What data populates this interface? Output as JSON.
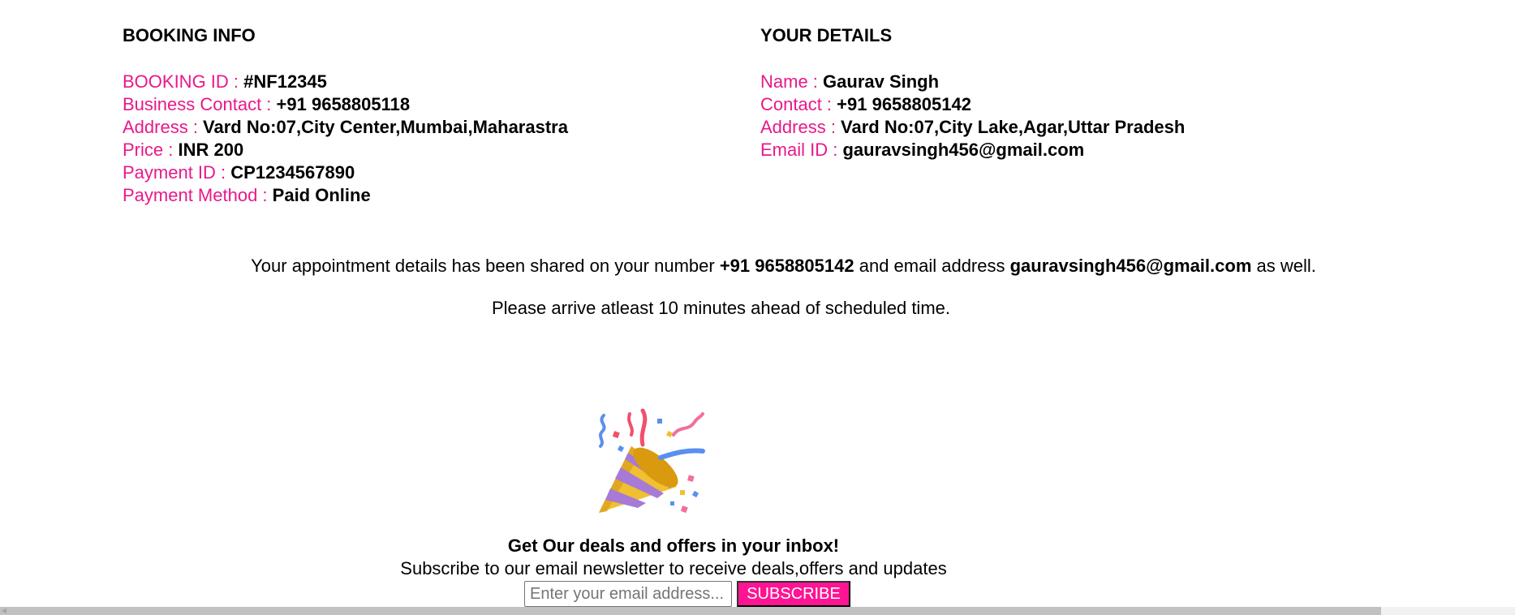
{
  "booking": {
    "heading": "BOOKING INFO",
    "rows": [
      {
        "label": "BOOKING ID : ",
        "value": "#NF12345"
      },
      {
        "label": "Business Contact : ",
        "value": "+91 9658805118"
      },
      {
        "label": "Address : ",
        "value": "Vard No:07,City Center,Mumbai,Maharastra"
      },
      {
        "label": "Price : ",
        "value": "INR 200"
      },
      {
        "label": "Payment ID : ",
        "value": "CP1234567890"
      },
      {
        "label": "Payment Method : ",
        "value": "Paid Online"
      }
    ]
  },
  "details": {
    "heading": "YOUR DETAILS",
    "rows": [
      {
        "label": "Name : ",
        "value": "Gaurav Singh"
      },
      {
        "label": "Contact : ",
        "value": "+91 9658805142"
      },
      {
        "label": "Address : ",
        "value": "Vard No:07,City Lake,Agar,Uttar Pradesh"
      },
      {
        "label": "Email ID : ",
        "value": "gauravsingh456@gmail.com"
      }
    ]
  },
  "notice": {
    "part1": "Your appointment details has been shared on your number ",
    "phone": "+91 9658805142",
    "part2": " and email address ",
    "email": "gauravsingh456@gmail.com",
    "part3": " as well.",
    "arrival": "Please arrive atleast 10 minutes ahead of scheduled time."
  },
  "celebration_icon": "party-popper-icon",
  "newsletter": {
    "title": "Get Our deals and offers in your inbox!",
    "subtitle": "Subscribe to our email newsletter to receive deals,offers and updates",
    "email_placeholder": "Enter your email address...",
    "email_value": "",
    "subscribe_label": "SUBSCRIBE"
  },
  "colors": {
    "label_accent": "#e8198a",
    "button_bg": "#ff1493"
  }
}
